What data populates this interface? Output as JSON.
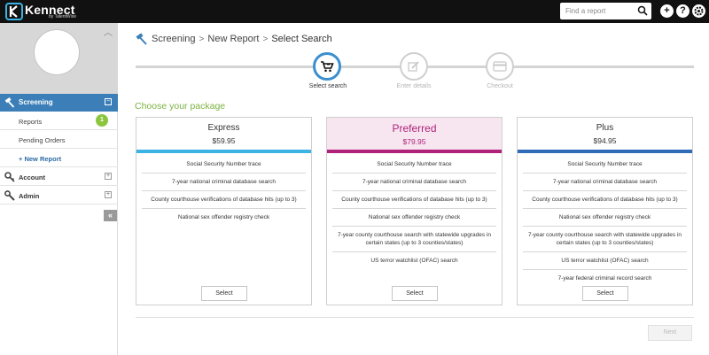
{
  "app": {
    "logo_text": "Kennect",
    "logo_sub": "by TalentWise",
    "search_placeholder": "Find a report",
    "top_icons": [
      "add-icon",
      "help-icon",
      "settings-icon"
    ]
  },
  "sidebar": {
    "active_item": {
      "label": "Screening",
      "icon": "hammer-icon",
      "toggle": "−"
    },
    "sub_items": [
      {
        "label": "Reports",
        "badge": "1"
      },
      {
        "label": "Pending Orders"
      },
      {
        "label": "+ New Report"
      }
    ],
    "items": [
      {
        "label": "Account",
        "icon": "key-icon",
        "toggle": "+"
      },
      {
        "label": "Admin",
        "icon": "wrench-icon",
        "toggle": "+"
      }
    ],
    "collapse_label": "«"
  },
  "breadcrumb": {
    "items": [
      "Screening",
      "New Report",
      "Select Search"
    ],
    "separator": ">"
  },
  "stepper": {
    "steps": [
      {
        "label": "Select search",
        "icon": "cart-icon",
        "state": "active"
      },
      {
        "label": "Enter details",
        "icon": "pencil-icon",
        "state": "inactive"
      },
      {
        "label": "Checkout",
        "icon": "credit-card-icon",
        "state": "inactive"
      }
    ]
  },
  "main": {
    "heading": "Choose your package",
    "packages": [
      {
        "name": "Express",
        "price": "$59.95",
        "color": "#3bb3e5",
        "features": [
          "Social Security Number trace",
          "7-year national criminal database search",
          "County courthouse verifications of database hits (up to 3)",
          "National sex offender registry check"
        ],
        "button": "Select"
      },
      {
        "name": "Preferred",
        "price": "$79.95",
        "color": "#b0227a",
        "features": [
          "Social Security Number trace",
          "7-year national criminal database search",
          "County courthouse verifications of database hits (up to 3)",
          "National sex offender registry check",
          "7-year county courthouse search with statewide upgrades in certain states (up to 3 counties/states)",
          "US terror watchlist (OFAC) search"
        ],
        "button": "Select"
      },
      {
        "name": "Plus",
        "price": "$94.95",
        "color": "#2f6bb8",
        "features": [
          "Social Security Number trace",
          "7-year national criminal database search",
          "County courthouse verifications of database hits (up to 3)",
          "National sex offender registry check",
          "7-year county courthouse search with statewide upgrades in certain states (up to 3 counties/states)",
          "US terror watchlist (OFAC) search",
          "7-year federal criminal record search"
        ],
        "button": "Select"
      }
    ],
    "next_label": "Next"
  }
}
